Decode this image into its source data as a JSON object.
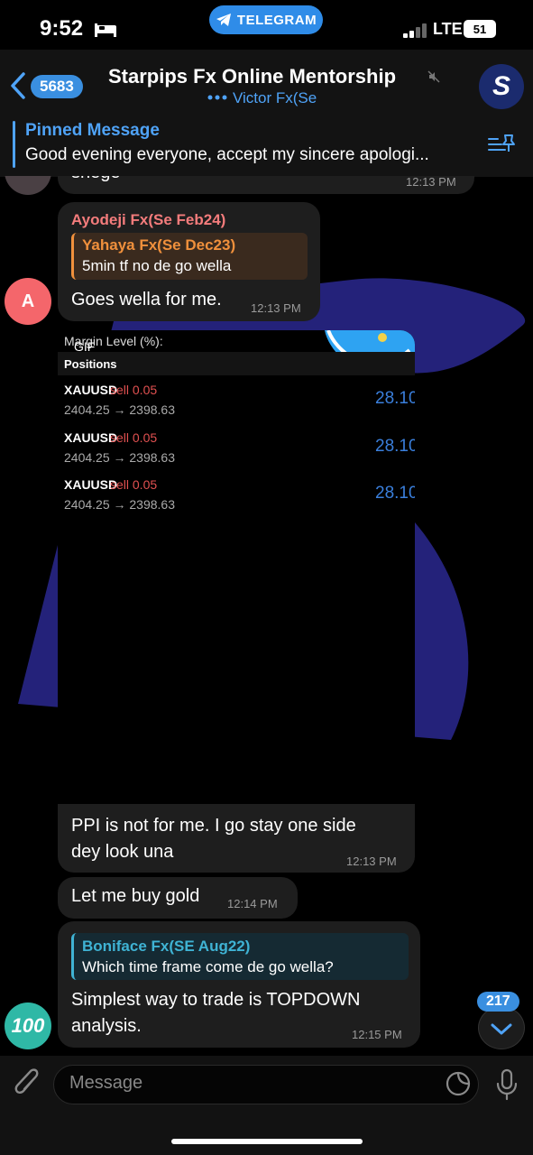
{
  "status_bar": {
    "time": "9:52",
    "app_pill": "TELEGRAM",
    "network": "LTE",
    "battery": "51"
  },
  "header": {
    "back_count": "5683",
    "title": "Starpips Fx Online Mentorship",
    "subtitle": "Victor Fx(Se",
    "avatar_letter": "S"
  },
  "pinned": {
    "label": "Pinned Message",
    "text": "Good evening everyone, accept my sincere apologi..."
  },
  "messages": {
    "m0": {
      "text": "shege",
      "time": "12:13 PM"
    },
    "m1": {
      "sender": "Ayodeji Fx(Se Feb24)",
      "sender_color": "#f47c7c",
      "reply_sender": "Yahaya Fx(Se Dec23)",
      "reply_text": "5min tf no de go wella",
      "text": "Goes wella for me.",
      "time": "12:13 PM",
      "avatar_letter": "A"
    },
    "m2": {
      "gif_label": "GIF",
      "caption_line1": "PPI is not for me. I go stay one side",
      "caption_line2": "dey look una",
      "time": "12:13 PM"
    },
    "m3": {
      "text": "Let me buy gold",
      "time": "12:14 PM"
    },
    "m4": {
      "reply_sender": "Boniface Fx(SE Aug22)",
      "reply_text": "Which time frame come de go wella?",
      "text_line1": "Simplest way to trade is TOPDOWN",
      "text_line2": "analysis.",
      "time": "12:15 PM",
      "avatar_text": "100"
    }
  },
  "media_content": {
    "margin_level": "Margin Level (%):",
    "positions_label": "Positions",
    "positions": [
      {
        "symbol": "XAUUSD",
        "side": "sell 0.05",
        "prices": "2404.25 → 2398.63",
        "profit": "28.10"
      },
      {
        "symbol": "XAUUSD",
        "side": "sell 0.05",
        "prices": "2404.25 → 2398.63",
        "profit": "28.10"
      },
      {
        "symbol": "XAUUSD",
        "side": "sell 0.05",
        "prices": "2404.25 → 2398.63",
        "profit": "28.10"
      }
    ]
  },
  "scroll": {
    "unread": "217"
  },
  "composer": {
    "placeholder": "Message"
  },
  "icons": [
    "back-chevron-icon",
    "mute-icon",
    "pin-list-icon",
    "attach-icon",
    "sticker-icon",
    "mic-icon",
    "chevron-down-icon",
    "bed-icon",
    "telegram-icon"
  ]
}
